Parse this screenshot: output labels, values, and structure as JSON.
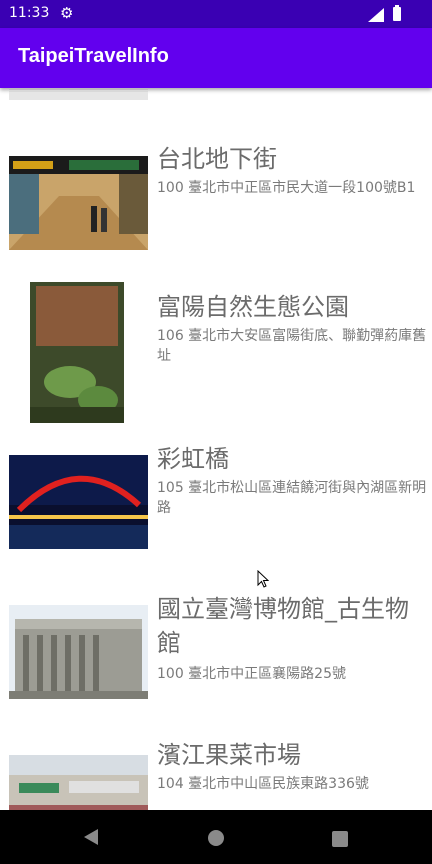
{
  "status_bar": {
    "time": "11:33",
    "settings_icon": "gear-icon",
    "signal_icon": "signal-icon",
    "battery_icon": "battery-icon"
  },
  "app_bar": {
    "title": "TaipeiTravelInfo"
  },
  "list": {
    "items": [
      {
        "title": "",
        "address": ""
      },
      {
        "title": "台北地下街",
        "address": "100 臺北市中正區市民大道一段100號B1"
      },
      {
        "title": "富陽自然生態公園",
        "address": "106 臺北市大安區富陽街底、聯勤彈葯庫舊址"
      },
      {
        "title": "彩虹橋",
        "address": "105 臺北市松山區連結饒河街與內湖區新明路"
      },
      {
        "title": "國立臺灣博物館_古生物館",
        "address": "100 臺北市中正區襄陽路25號"
      },
      {
        "title": "濱江果菜市場",
        "address": "104 臺北市中山區民族東路336號"
      }
    ]
  },
  "nav_bar": {
    "back_icon": "back-triangle-icon",
    "home_icon": "home-circle-icon",
    "recents_icon": "recents-square-icon"
  },
  "colors": {
    "status_bar": "#3a00b3",
    "app_bar": "#6200ee",
    "nav_bar": "#000000"
  }
}
